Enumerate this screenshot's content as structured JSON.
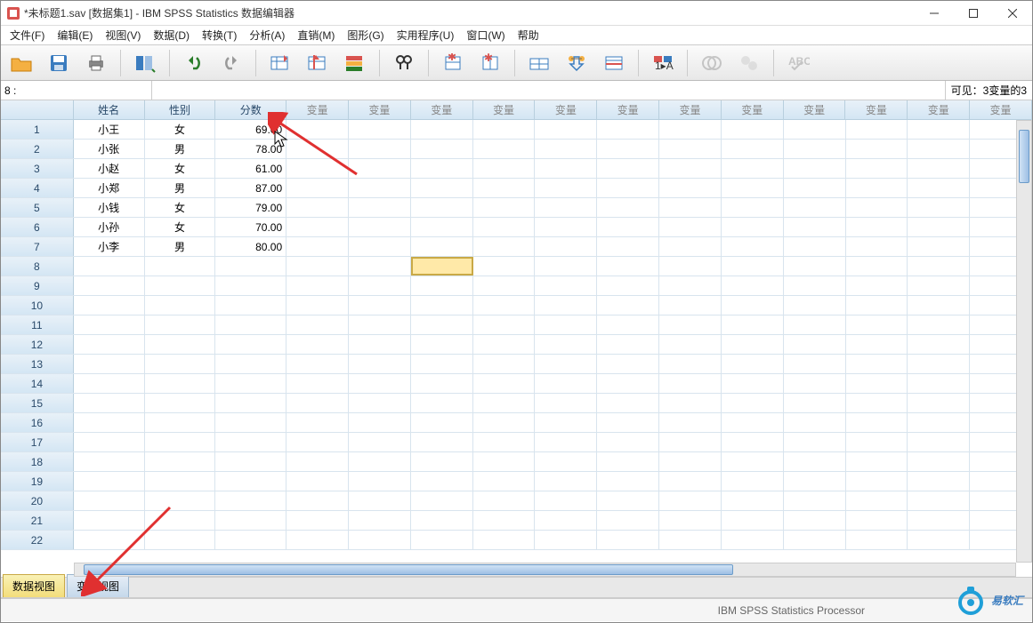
{
  "window": {
    "title": "*未标题1.sav [数据集1] - IBM SPSS Statistics 数据编辑器"
  },
  "menu": {
    "items": [
      "文件(F)",
      "编辑(E)",
      "视图(V)",
      "数据(D)",
      "转换(T)",
      "分析(A)",
      "直销(M)",
      "图形(G)",
      "实用程序(U)",
      "窗口(W)",
      "帮助"
    ]
  },
  "address": {
    "label": "8 :",
    "value": "",
    "visible_info": "可见：3变量的3"
  },
  "columns": {
    "named": [
      "姓名",
      "性别",
      "分数"
    ],
    "empty_label": "变量",
    "empty_count": 12
  },
  "rows": [
    {
      "n": 1,
      "name": "小王",
      "gender": "女",
      "score": "69.00"
    },
    {
      "n": 2,
      "name": "小张",
      "gender": "男",
      "score": "78.00"
    },
    {
      "n": 3,
      "name": "小赵",
      "gender": "女",
      "score": "61.00"
    },
    {
      "n": 4,
      "name": "小郑",
      "gender": "男",
      "score": "87.00"
    },
    {
      "n": 5,
      "name": "小钱",
      "gender": "女",
      "score": "79.00"
    },
    {
      "n": 6,
      "name": "小孙",
      "gender": "女",
      "score": "70.00"
    },
    {
      "n": 7,
      "name": "小李",
      "gender": "男",
      "score": "80.00"
    }
  ],
  "empty_row_start": 8,
  "empty_row_end": 22,
  "selected_cell": {
    "row": 8,
    "col_index": 5
  },
  "tabs": {
    "data_view": "数据视图",
    "variable_view": "变量视图"
  },
  "status": {
    "processor": "IBM SPSS Statistics Processor"
  },
  "watermark": {
    "text": "易软汇"
  }
}
